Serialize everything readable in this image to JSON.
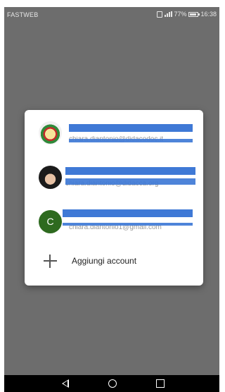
{
  "status_bar": {
    "carrier": "FASTWEB",
    "signal_label": "℃ℂ²",
    "battery_percent": "77%",
    "battery_level": 0.77,
    "time": "16:38"
  },
  "dialog": {
    "accounts": [
      {
        "avatar": "school-logo",
        "avatar_letter": "",
        "email": "chiara.diantonio@didacodoc.it"
      },
      {
        "avatar": "profile-photo",
        "avatar_letter": "",
        "email": "chiara.diantonio@didacca.org"
      },
      {
        "avatar": "letter",
        "avatar_letter": "C",
        "email": "chiara.diantonio1@gmail.com"
      }
    ],
    "add_account_label": "Aggiungi account"
  },
  "navigation": {
    "back_icon": "back-triangle-icon",
    "home_icon": "home-circle-icon",
    "recent_icon": "recent-square-icon"
  },
  "colors": {
    "overlay": "#6d6d6d",
    "redaction": "#3f79d6",
    "letter_avatar": "#2e6a1f"
  }
}
